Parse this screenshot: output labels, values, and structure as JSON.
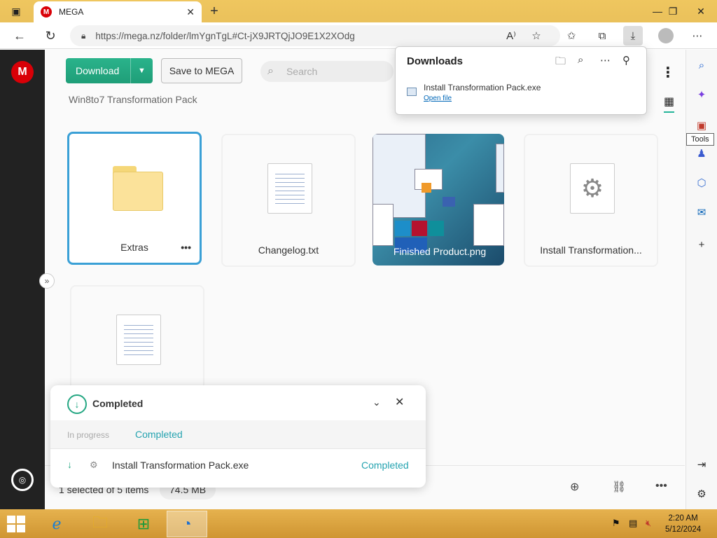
{
  "browser": {
    "tab_title": "MEGA",
    "tab_favicon": "M",
    "url": "https://mega.nz/folder/lmYgnTgL#Ct-jX9JRTQjJO9E1X2XOdg"
  },
  "toolbar": {
    "download_label": "Download",
    "save_label": "Save to MEGA",
    "search_placeholder": "Search",
    "breadcrumb": "Win8to7 Transformation Pack"
  },
  "files": [
    {
      "name": "Extras",
      "type": "folder",
      "selected": true
    },
    {
      "name": "Changelog.txt",
      "type": "text"
    },
    {
      "name": "Finished Product.png",
      "type": "image"
    },
    {
      "name": "Install Transformation...",
      "type": "exe"
    },
    {
      "name": "",
      "type": "text"
    }
  ],
  "downloads_panel": {
    "title": "Downloads",
    "file_name": "Install Transformation Pack.exe",
    "open_link": "Open file"
  },
  "tooltip": "Tools",
  "transfer": {
    "title": "Completed",
    "tab_in_progress": "In progress",
    "tab_completed": "Completed",
    "item_name": "Install Transformation Pack.exe",
    "item_status": "Completed"
  },
  "status_bar": {
    "selection": "1 selected of 5 items",
    "size": "74.5 MB"
  },
  "taskbar": {
    "time": "2:20 AM",
    "date": "5/12/2024"
  },
  "colors": {
    "mega_red": "#d90007",
    "mega_green": "#25a783",
    "selection_blue": "#3aa0d6",
    "taskbar": "#e0a842"
  }
}
